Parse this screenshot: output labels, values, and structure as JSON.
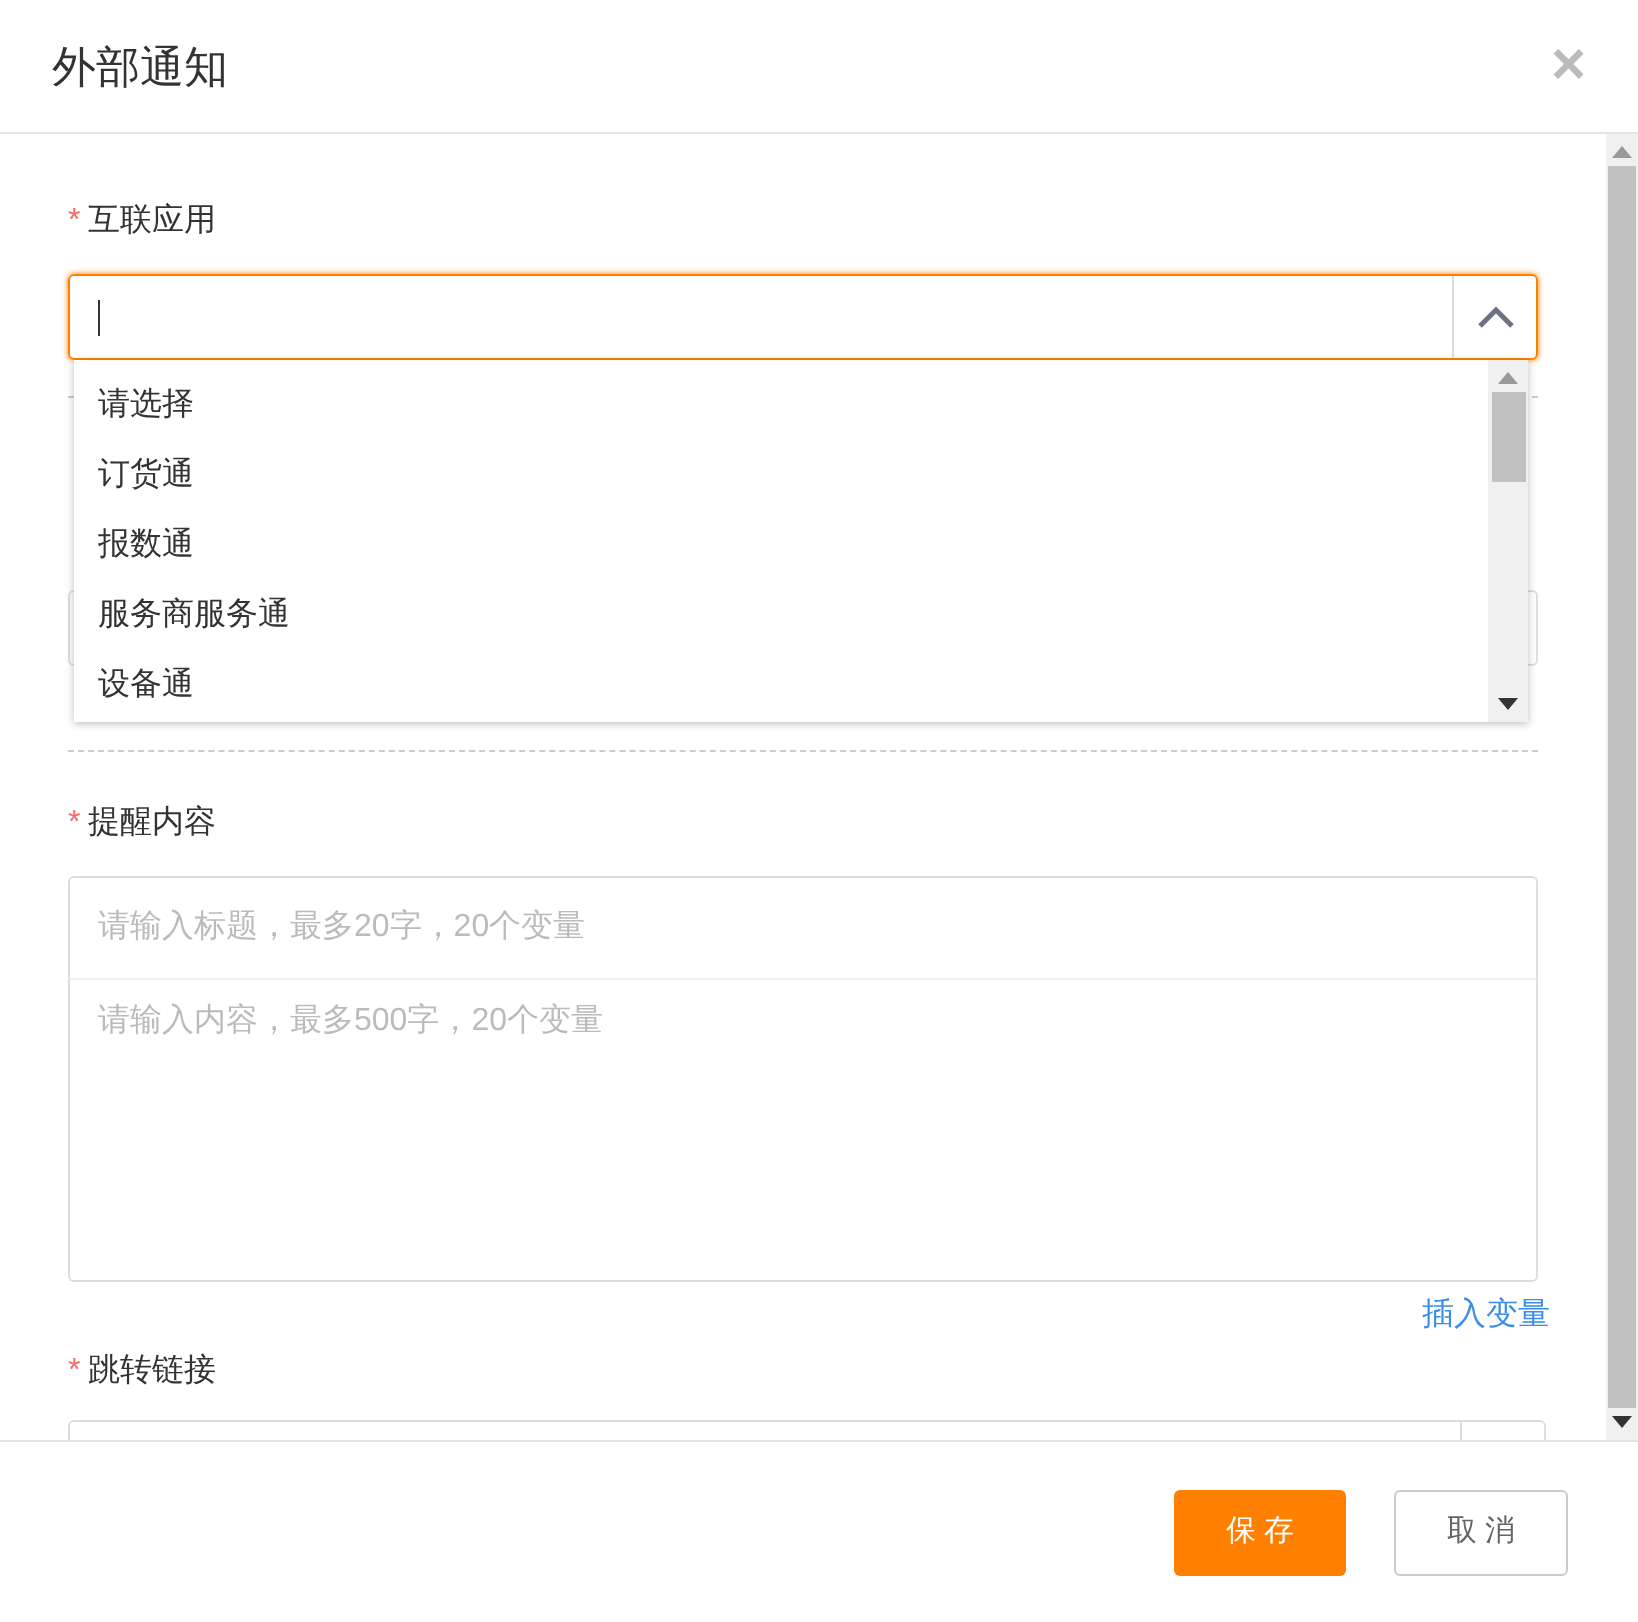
{
  "dialog": {
    "title": "外部通知",
    "close": "×"
  },
  "app_field": {
    "label": "互联应用",
    "marker": "*",
    "expanded": true
  },
  "dropdown": {
    "options": [
      {
        "label": "请选择",
        "selected": false
      },
      {
        "label": "订货通",
        "selected": false
      },
      {
        "label": "报数通",
        "selected": false
      },
      {
        "label": "服务商服务通",
        "selected": false
      },
      {
        "label": "设备通",
        "selected": false
      }
    ]
  },
  "content": {
    "label": "提醒内容",
    "marker": "*",
    "title_placeholder": "请输入标题，最多20字，20个变量",
    "body_placeholder": "请输入内容，最多500字，20个变量",
    "insert_link": "插入变量"
  },
  "jump_link": {
    "label": "跳转链接",
    "marker": "*"
  },
  "buttons": [
    {
      "label": "保 存",
      "kind": "primary"
    },
    {
      "label": "取 消",
      "kind": "secondary"
    }
  ]
}
